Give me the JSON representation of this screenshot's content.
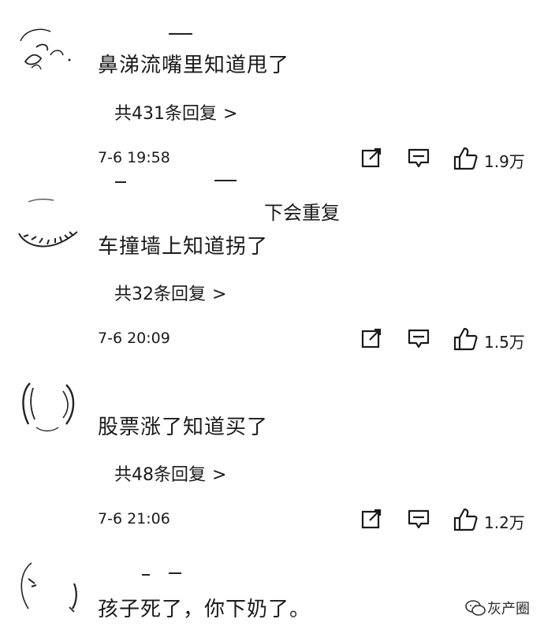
{
  "comments": [
    {
      "text": "鼻涕流嘴里知道甩了",
      "replies": "共431条回复",
      "chevron": ">",
      "time": "7-6 19:58",
      "likes": "1.9万"
    },
    {
      "text": "车撞墙上知道拐了",
      "replies": "共32条回复",
      "chevron": ">",
      "time": "7-6 20:09",
      "likes": "1.5万"
    },
    {
      "text": "股票涨了知道买了",
      "replies": "共48条回复",
      "chevron": ">",
      "time": "7-6 21:06",
      "likes": "1.2万"
    },
    {
      "text": "孩子死了，你下奶了。"
    }
  ],
  "overlay": {
    "truncated_text": "下会重复"
  },
  "watermark": {
    "text": "灰产圈"
  },
  "icons": {
    "share": "share-edit-icon",
    "comment": "comment-bubble-icon",
    "like": "thumbs-up-icon",
    "watermark": "wechat-logo-icon"
  }
}
